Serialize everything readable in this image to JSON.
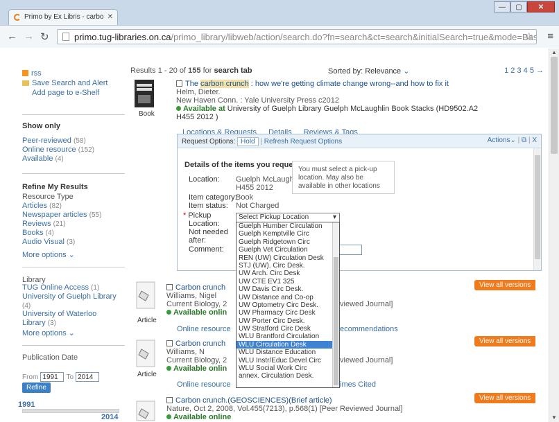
{
  "browser": {
    "tab_title": "Primo by Ex Libris - carbo",
    "url_host": "primo.tug-libraries.on.ca",
    "url_path": "/primo_library/libweb/action/search.do?fn=search&ct=search&initialSearch=true&mode=Basi"
  },
  "sidebar": {
    "rss": "rss",
    "save_search": "Save Search and Alert",
    "add_page": "Add page to e-Shelf",
    "show_only": "Show only",
    "show_only_items": [
      {
        "label": "Peer-reviewed",
        "count": "(58)"
      },
      {
        "label": "Online resource",
        "count": "(152)"
      },
      {
        "label": "Available",
        "count": "(4)"
      }
    ],
    "refine_title": "Refine My Results",
    "resource_type": "Resource Type",
    "resource_items": [
      {
        "label": "Articles",
        "count": "(82)"
      },
      {
        "label": "Newspaper articles",
        "count": "(55)"
      },
      {
        "label": "Reviews",
        "count": "(21)"
      },
      {
        "label": "Books",
        "count": "(4)"
      },
      {
        "label": "Audio Visual",
        "count": "(3)"
      }
    ],
    "more_options": "More options",
    "library_title": "Library",
    "library_items": [
      {
        "label": "TUG Online Access",
        "count": "(1)"
      },
      {
        "label": "University of Guelph Library",
        "count": "(4)"
      },
      {
        "label": "University of Waterloo Library",
        "count": "(3)"
      }
    ],
    "pubdate_title": "Publication Date",
    "from_label": "From",
    "from_value": "1991",
    "to_label": "To",
    "to_value": "2014",
    "refine_btn": "Refine",
    "slider_min": "1991",
    "slider_max": "2014"
  },
  "results": {
    "range": "Results 1 - 20 of",
    "total": "155",
    "for": "for",
    "scope": "search tab",
    "sorted_label": "Sorted by:",
    "sorted_value": "Relevance",
    "pages": "1 2 3 4 5 →"
  },
  "record1": {
    "title_hl": "carbon crunch",
    "title_pre": "The ",
    "title_post": " : how we're getting climate change wrong--and how to fix it",
    "author": "Helm, Dieter.",
    "pub": "New Haven Conn. : Yale University Press c2012",
    "avail_prefix": "Available at",
    "avail_text": "University of Guelph Library Guelph McLaughlin Book Stacks (HD9502.A2",
    "avail_text2": "H455 2012 )",
    "type": "Book",
    "tab_locations": "Locations & Requests",
    "tab_details": "Details",
    "tab_reviews": "Reviews & Tags"
  },
  "request": {
    "options_label": "Request Options:",
    "hold": "Hold",
    "refresh": "Refresh Request Options",
    "actions": "Actions",
    "details_title": "Details of the items you requested:",
    "location_label": "Location:",
    "location_value": "Guelph McLaughlin Book Stacks ,HD9502.A2",
    "location_value2": "H455 2012",
    "category_label": "Item category:",
    "category_value": "Book",
    "status_label": "Item status:",
    "status_value": "Not Charged",
    "pickup_label": "Pickup",
    "pickup_label2": "Location:",
    "notneeded_label": "Not needed",
    "notneeded_label2": "after:",
    "comment_label": "Comment:",
    "notice": "You must select a pick-up location. May also be available in other locations",
    "select_value": "Select Pickup Location",
    "options": [
      "Guelph Humber Circulation",
      "Guelph Kemptville Circ",
      "Guelph Ridgetown Circ",
      "Guelph Vet Circulation",
      "REN (UW) Circulation Desk",
      "STJ (UW). Circ Desk.",
      "UW Arch. Circ Desk",
      "UW CTE EV1 325",
      "UW Davis Circ Desk.",
      "UW Distance and Co-op",
      "UW Optometry Circ Desk.",
      "UW Pharmacy Circ Desk",
      "UW Porter Circ Desk.",
      "UW Stratford Circ Desk",
      "WLU Brantford Circulation",
      "WLU Circulation Desk",
      "WLU Distance Education",
      "WLU Instr/Educ Devel Circ",
      "WLU Social Work Circ",
      "annex. Circulation Desk."
    ],
    "selected_index": 15
  },
  "record2": {
    "title": "Carbon crunch",
    "author": "Williams, Nigel",
    "pub": "Current Biology, 2",
    "pub_tail": "viewed Journal]",
    "avail": "Available onlin",
    "type": "Article",
    "link1": "Online resource",
    "link2": "ecommendations",
    "view_all": "View all versions"
  },
  "record3": {
    "title": "Carbon crunch",
    "author": "Williams, N",
    "pub": "Current Biology, 2",
    "pub_tail": "viewed Journal]",
    "avail": "Available onlin",
    "type": "Article",
    "link1": "Online resource",
    "link2": "imes Cited",
    "view_all": "View all versions"
  },
  "record4": {
    "title": "Carbon crunch.(GEOSCIENCES)(Brief article)",
    "pub": "Nature, Oct 2, 2008, Vol.455(7213), p.568(1) [Peer Reviewed Journal]",
    "avail": "Available online",
    "view_all": "View all versions"
  }
}
